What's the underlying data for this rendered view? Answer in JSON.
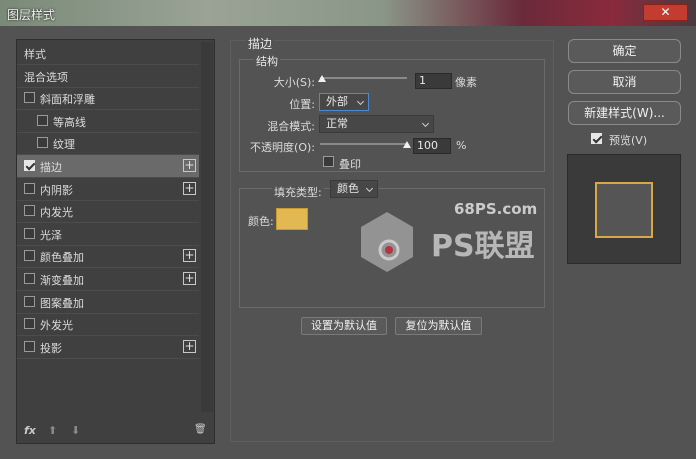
{
  "window": {
    "title": "图层样式",
    "close_icon": "✕"
  },
  "sidebar": {
    "items": [
      {
        "label": "样式",
        "has_checkbox": false,
        "checked": false,
        "plus": false,
        "selected": false,
        "indent": 0
      },
      {
        "label": "混合选项",
        "has_checkbox": false,
        "checked": false,
        "plus": false,
        "selected": false,
        "indent": 0
      },
      {
        "label": "斜面和浮雕",
        "has_checkbox": true,
        "checked": false,
        "plus": false,
        "selected": false,
        "indent": 0
      },
      {
        "label": "等高线",
        "has_checkbox": true,
        "checked": false,
        "plus": false,
        "selected": false,
        "indent": 1
      },
      {
        "label": "纹理",
        "has_checkbox": true,
        "checked": false,
        "plus": false,
        "selected": false,
        "indent": 1
      },
      {
        "label": "描边",
        "has_checkbox": true,
        "checked": true,
        "plus": true,
        "selected": true,
        "indent": 0
      },
      {
        "label": "内阴影",
        "has_checkbox": true,
        "checked": false,
        "plus": true,
        "selected": false,
        "indent": 0
      },
      {
        "label": "内发光",
        "has_checkbox": true,
        "checked": false,
        "plus": false,
        "selected": false,
        "indent": 0
      },
      {
        "label": "光泽",
        "has_checkbox": true,
        "checked": false,
        "plus": false,
        "selected": false,
        "indent": 0
      },
      {
        "label": "颜色叠加",
        "has_checkbox": true,
        "checked": false,
        "plus": true,
        "selected": false,
        "indent": 0
      },
      {
        "label": "渐变叠加",
        "has_checkbox": true,
        "checked": false,
        "plus": true,
        "selected": false,
        "indent": 0
      },
      {
        "label": "图案叠加",
        "has_checkbox": true,
        "checked": false,
        "plus": false,
        "selected": false,
        "indent": 0
      },
      {
        "label": "外发光",
        "has_checkbox": true,
        "checked": false,
        "plus": false,
        "selected": false,
        "indent": 0
      },
      {
        "label": "投影",
        "has_checkbox": true,
        "checked": false,
        "plus": true,
        "selected": false,
        "indent": 0
      }
    ],
    "bottom": {
      "fx": "fx",
      "up": "⬆",
      "down": "⬇",
      "trash": "🗑"
    }
  },
  "stroke": {
    "section_title": "描边",
    "structure_title": "结构",
    "size_label": "大小(S):",
    "size_value": "1",
    "size_unit": "像素",
    "size_slider": 0.02,
    "position_label": "位置:",
    "position_value": "外部",
    "blend_label": "混合模式:",
    "blend_value": "正常",
    "opacity_label": "不透明度(O):",
    "opacity_value": "100",
    "opacity_unit": "%",
    "opacity_slider": 1.0,
    "overprint_label": "叠印",
    "fill_type_label": "填充类型:",
    "fill_type_value": "颜色",
    "color_label": "颜色:",
    "color_hex": "#e2b852",
    "set_default": "设置为默认值",
    "reset_default": "复位为默认值"
  },
  "right": {
    "ok": "确定",
    "cancel": "取消",
    "new_style": "新建样式(W)...",
    "preview_label": "预览(V)",
    "preview_checked": true
  },
  "watermark": {
    "site": "68PS.com",
    "brand": "PS联盟"
  }
}
